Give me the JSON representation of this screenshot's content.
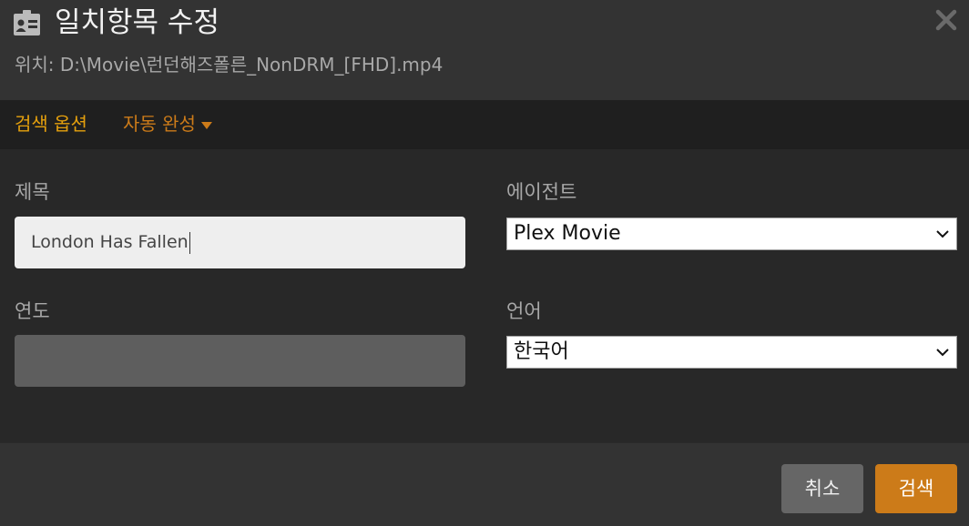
{
  "header": {
    "title": "일치항목 수정",
    "path_label": "위치: D:\\Movie\\런던해즈폴른_NonDRM_[FHD].mp4",
    "title_icon": "id-card-icon",
    "close_icon": "close-icon"
  },
  "options": {
    "search_options_label": "검색 옵션",
    "autocomplete_label": "자동 완성"
  },
  "form": {
    "title_label": "제목",
    "title_value": "London Has Fallen",
    "year_label": "연도",
    "year_value": "",
    "agent_label": "에이전트",
    "agent_value": "Plex Movie",
    "language_label": "언어",
    "language_value": "한국어"
  },
  "footer": {
    "cancel_label": "취소",
    "search_label": "검색"
  },
  "colors": {
    "accent": "#cc7b19",
    "accent_light": "#e5a00d",
    "background": "#333333",
    "body": "#282828",
    "bar": "#1f1f1f"
  }
}
